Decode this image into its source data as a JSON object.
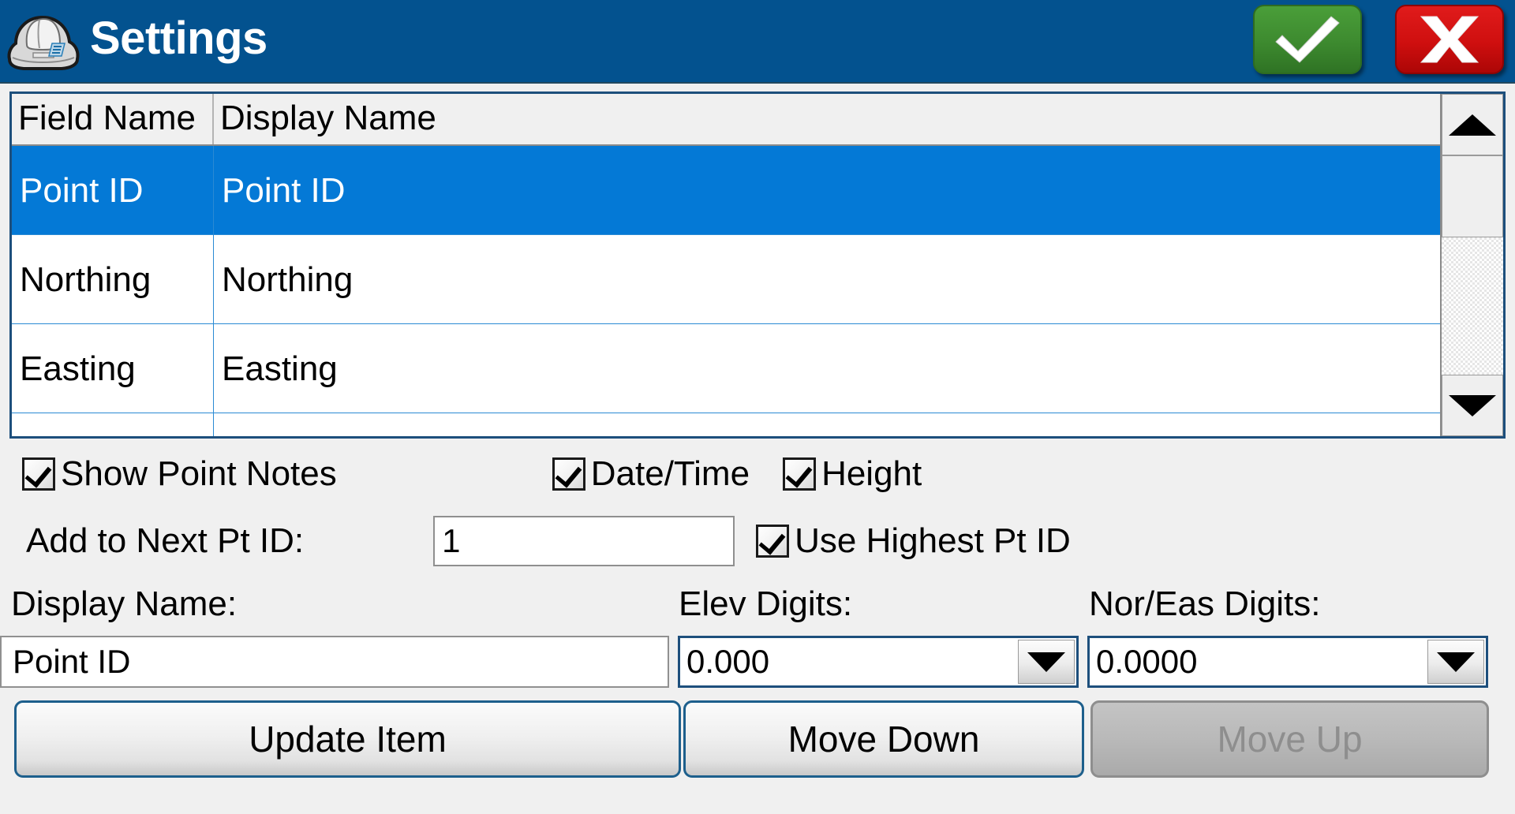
{
  "window": {
    "title": "Settings",
    "icon": "hard-hat-icon",
    "titlebar_color": "#03528f",
    "accent_selection_color": "#0479d6"
  },
  "titlebar_actions": {
    "ok": {
      "icon": "checkmark-icon",
      "color": "#3d8a2f",
      "label": "OK"
    },
    "cancel": {
      "icon": "x-icon",
      "color": "#cf0f0f",
      "label": "Cancel"
    }
  },
  "grid": {
    "columns": [
      "Field Name",
      "Display Name"
    ],
    "rows": [
      {
        "field_name": "Point ID",
        "display_name": "Point ID",
        "selected": true
      },
      {
        "field_name": "Northing",
        "display_name": "Northing",
        "selected": false
      },
      {
        "field_name": "Easting",
        "display_name": "Easting",
        "selected": false
      }
    ],
    "scrollbar": {
      "up_icon": "triangle-up-icon",
      "down_icon": "triangle-down-icon"
    }
  },
  "checkboxes": {
    "show_point_notes": {
      "label": "Show Point Notes",
      "checked": true
    },
    "date_time": {
      "label": "Date/Time",
      "checked": true
    },
    "height": {
      "label": "Height",
      "checked": true
    },
    "use_highest_pt_id": {
      "label": "Use Highest Pt ID",
      "checked": true
    }
  },
  "add_to_next_pt_id": {
    "label": "Add to Next Pt ID:",
    "value": "1",
    "placeholder": ""
  },
  "fields": {
    "display_name": {
      "label": "Display Name:",
      "value": "Point ID",
      "placeholder": ""
    },
    "elev_digits": {
      "label": "Elev Digits:",
      "value": "0.000",
      "dropdown_icon": "chevron-down-icon"
    },
    "nor_eas_digits": {
      "label": "Nor/Eas Digits:",
      "value": "0.0000",
      "dropdown_icon": "chevron-down-icon"
    }
  },
  "buttons": {
    "update_item": {
      "label": "Update Item",
      "enabled": true
    },
    "move_down": {
      "label": "Move Down",
      "enabled": true
    },
    "move_up": {
      "label": "Move Up",
      "enabled": false
    }
  }
}
